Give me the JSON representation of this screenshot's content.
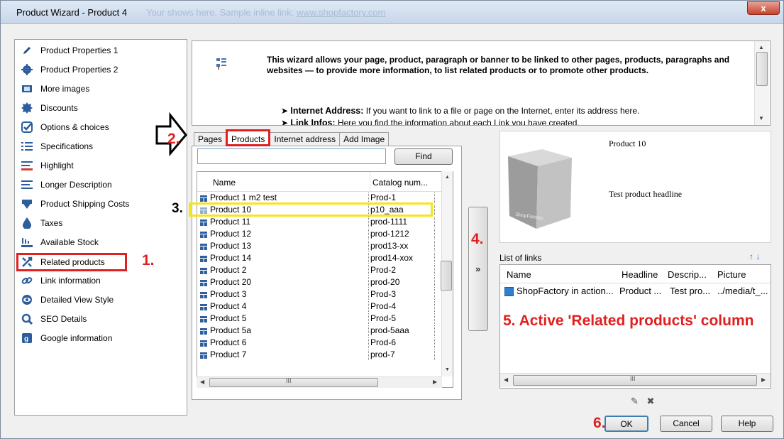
{
  "window": {
    "title": "Product Wizard - Product 4",
    "title_ghost": "Your shows here. Sample inline link:",
    "title_ghost_link": "www.shopfactory.com",
    "close_label": "x"
  },
  "sidebar": {
    "items": [
      {
        "label": "Product Properties 1",
        "icon": "pencil-icon"
      },
      {
        "label": "Product Properties 2",
        "icon": "gear-icon"
      },
      {
        "label": "More images",
        "icon": "images-icon"
      },
      {
        "label": "Discounts",
        "icon": "discount-badge-icon"
      },
      {
        "label": "Options & choices",
        "icon": "checkmark-icon"
      },
      {
        "label": "Specifications",
        "icon": "list-icon"
      },
      {
        "label": "Highlight",
        "icon": "highlight-icon"
      },
      {
        "label": "Longer Description",
        "icon": "text-lines-icon"
      },
      {
        "label": "Product Shipping Costs",
        "icon": "shipping-icon"
      },
      {
        "label": "Taxes",
        "icon": "drop-icon"
      },
      {
        "label": "Available Stock",
        "icon": "stock-icon"
      },
      {
        "label": "Related products",
        "icon": "related-icon"
      },
      {
        "label": "Link information",
        "icon": "link-icon"
      },
      {
        "label": "Detailed View Style",
        "icon": "eye-icon"
      },
      {
        "label": "SEO Details",
        "icon": "magnifier-icon"
      },
      {
        "label": "Google information",
        "icon": "google-icon"
      }
    ]
  },
  "annotations": {
    "n1": "1.",
    "n2": "2.",
    "n3": "3.",
    "n4": "4.",
    "n5": "5. Active 'Related products' column",
    "n6": "6."
  },
  "wizard": {
    "heading": "This wizard allows your page, product, paragraph or banner to be linked to other pages, products, paragraphs and websites — to provide more information, to list related products or to promote other products.",
    "bullet1_title": "Internet Address:",
    "bullet1_text": "If you want to link to a file or page on the Internet, enter its address here.",
    "bullet2_title": "Link Infos:",
    "bullet2_text": "Here you find the information about each Link you have created."
  },
  "tabs": [
    "Pages",
    "Products",
    "Internet address",
    "Add Image"
  ],
  "search": {
    "value": "",
    "find_label": "Find"
  },
  "list": {
    "columns": [
      "Name",
      "Catalog num..."
    ],
    "rows": [
      {
        "name": "Product 1 m2 test",
        "catalog": "Prod-1"
      },
      {
        "name": "Product 10",
        "catalog": "p10_aaa"
      },
      {
        "name": "Product 11",
        "catalog": "prod-1111"
      },
      {
        "name": "Product 12",
        "catalog": "prod-1212"
      },
      {
        "name": "Product 13",
        "catalog": "prod13-xx"
      },
      {
        "name": "Product 14",
        "catalog": "prod14-xox"
      },
      {
        "name": "Product 2",
        "catalog": "Prod-2"
      },
      {
        "name": "Product 20",
        "catalog": "prod-20"
      },
      {
        "name": "Product 3",
        "catalog": "Prod-3"
      },
      {
        "name": "Product 4",
        "catalog": "Prod-4"
      },
      {
        "name": "Product 5",
        "catalog": "Prod-5"
      },
      {
        "name": "Product 5a",
        "catalog": "prod-5aaa"
      },
      {
        "name": "Product 6",
        "catalog": "Prod-6"
      },
      {
        "name": "Product 7",
        "catalog": "prod-7"
      }
    ],
    "scroll_grip": "III"
  },
  "add_button": "»",
  "preview": {
    "title": "Product 10",
    "headline": "Test product headline",
    "cube_label": "ShopFactory"
  },
  "links": {
    "label": "List of links",
    "arrows": "↑ ↓",
    "columns": [
      "Name",
      "Headline",
      "Descrip...",
      "Picture"
    ],
    "rows": [
      {
        "name": "ShopFactory in action...",
        "headline": "Product ...",
        "description": "Test pro...",
        "picture": "../media/t_..."
      }
    ],
    "scroll_grip": "III"
  },
  "link_tools": {
    "edit": "✎",
    "delete": "✖"
  },
  "buttons": {
    "ok": "OK",
    "cancel": "Cancel",
    "help": "Help"
  },
  "colors": {
    "annotation_red": "#e02020",
    "highlight_yellow": "#f5e61c",
    "selection_blue": "#3c7fb1"
  }
}
